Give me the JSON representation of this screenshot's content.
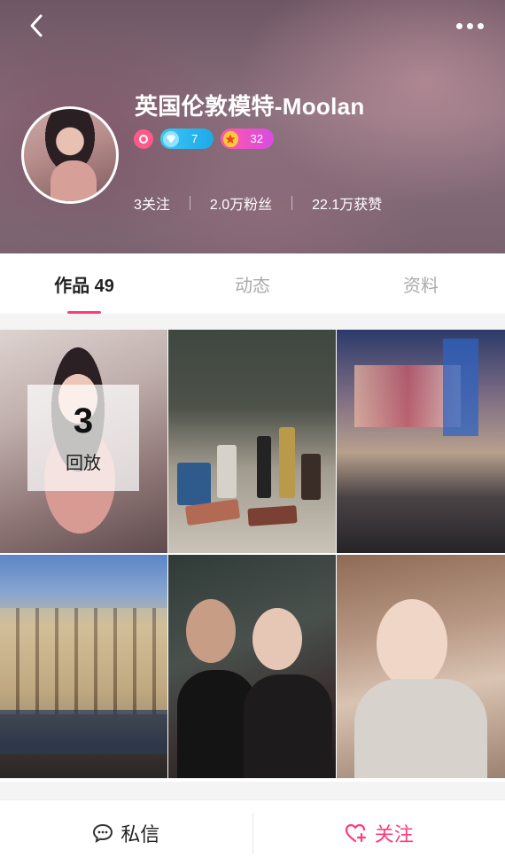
{
  "header": {
    "username": "英国伦敦模特-Moolan",
    "badges": {
      "diamond_count": "7",
      "star_count": "32"
    },
    "stats": {
      "following": "3关注",
      "fans": "2.0万粉丝",
      "likes": "22.1万获赞"
    }
  },
  "tabs": [
    {
      "label": "作品 49",
      "active": true
    },
    {
      "label": "动态",
      "active": false
    },
    {
      "label": "资料",
      "active": false
    }
  ],
  "grid": {
    "replay": {
      "count": "3",
      "label": "回放"
    }
  },
  "bottom": {
    "message_label": "私信",
    "follow_label": "关注"
  },
  "colors": {
    "accent": "#ff3b7a",
    "diamond_pill": "#20a8e8",
    "star_pill": "#d94be3"
  }
}
